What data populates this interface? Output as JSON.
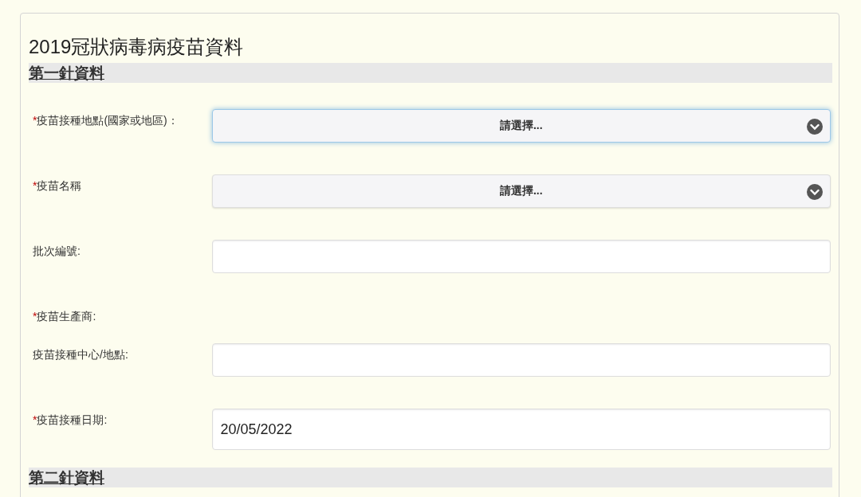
{
  "title": "2019冠狀病毒病疫苗資料",
  "sections": [
    {
      "heading": "第一針資料",
      "fields": [
        {
          "kind": "select",
          "asterisk": "*",
          "label": "疫苗接種地點(國家或地區)：",
          "value": "請選擇...",
          "focused": true
        },
        {
          "kind": "select",
          "asterisk": "*",
          "label": "疫苗名稱",
          "value": "請選擇...",
          "focused": false
        },
        {
          "kind": "text",
          "label": "批次編號:",
          "focused": false
        },
        {
          "kind": "none",
          "asterisk": "*",
          "label": "疫苗生產商:"
        },
        {
          "kind": "text",
          "label": "疫苗接種中心/地點:",
          "focused": false
        },
        {
          "kind": "date",
          "asterisk": "*",
          "label": "疫苗接種日期:",
          "value": "20/05/2022",
          "focused": false
        }
      ]
    },
    {
      "heading": "第二針資料"
    }
  ]
}
